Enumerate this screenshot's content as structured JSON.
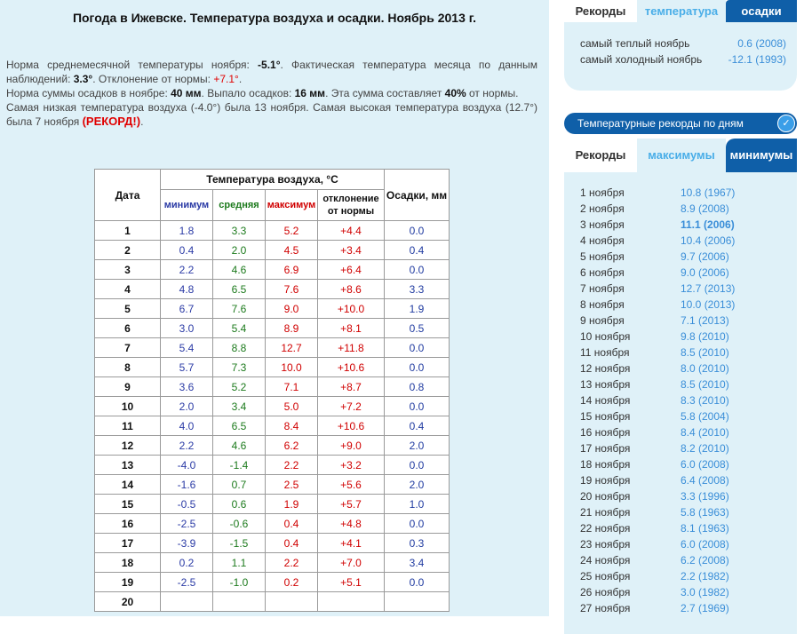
{
  "page": {
    "title": "Погода в Ижевске. Температура воздуха и осадки. Ноябрь 2013 г."
  },
  "summary": {
    "p1": {
      "t1": "Норма среднемесячной температуры ноября: ",
      "norm": "-5.1°",
      "t2": ". Фактическая температура месяца по данным наблюдений: ",
      "actual": "3.3°",
      "t3": ". Отклонение от нормы: ",
      "dev": "+7.1°",
      "t4": "."
    },
    "p2": {
      "t1": "Норма суммы осадков в ноябре: ",
      "norm": "40 мм",
      "t2": ". Выпало осадков: ",
      "fell": "16 мм",
      "t3": ". Эта сумма составляет ",
      "pct": "40%",
      "t4": " от нормы."
    },
    "p3": {
      "t1": "Самая низкая температура воздуха (-4.0°) была 13 ноября. Самая высокая температура воздуха (12.7°) была 7 ноября ",
      "record": "(РЕКОРД!)",
      "t2": "."
    }
  },
  "table": {
    "headers": {
      "date": "Дата",
      "temp": "Температура воздуха, °С",
      "min": "минимум",
      "avg": "средняя",
      "max": "максимум",
      "dev_line1": "отклонение",
      "dev_line2": "от нормы",
      "precip": "Осадки, мм"
    },
    "rows": [
      {
        "d": "1",
        "min": "1.8",
        "avg": "3.3",
        "max": "5.2",
        "dev": "+4.4",
        "p": "0.0"
      },
      {
        "d": "2",
        "min": "0.4",
        "avg": "2.0",
        "max": "4.5",
        "dev": "+3.4",
        "p": "0.4"
      },
      {
        "d": "3",
        "min": "2.2",
        "avg": "4.6",
        "max": "6.9",
        "dev": "+6.4",
        "p": "0.0"
      },
      {
        "d": "4",
        "min": "4.8",
        "avg": "6.5",
        "max": "7.6",
        "dev": "+8.6",
        "p": "3.3"
      },
      {
        "d": "5",
        "min": "6.7",
        "avg": "7.6",
        "max": "9.0",
        "dev": "+10.0",
        "p": "1.9"
      },
      {
        "d": "6",
        "min": "3.0",
        "avg": "5.4",
        "max": "8.9",
        "dev": "+8.1",
        "p": "0.5"
      },
      {
        "d": "7",
        "min": "5.4",
        "avg": "8.8",
        "max": "12.7",
        "dev": "+11.8",
        "p": "0.0"
      },
      {
        "d": "8",
        "min": "5.7",
        "avg": "7.3",
        "max": "10.0",
        "dev": "+10.6",
        "p": "0.0"
      },
      {
        "d": "9",
        "min": "3.6",
        "avg": "5.2",
        "max": "7.1",
        "dev": "+8.7",
        "p": "0.8"
      },
      {
        "d": "10",
        "min": "2.0",
        "avg": "3.4",
        "max": "5.0",
        "dev": "+7.2",
        "p": "0.0"
      },
      {
        "d": "11",
        "min": "4.0",
        "avg": "6.5",
        "max": "8.4",
        "dev": "+10.6",
        "p": "0.4"
      },
      {
        "d": "12",
        "min": "2.2",
        "avg": "4.6",
        "max": "6.2",
        "dev": "+9.0",
        "p": "2.0"
      },
      {
        "d": "13",
        "min": "-4.0",
        "avg": "-1.4",
        "max": "2.2",
        "dev": "+3.2",
        "p": "0.0"
      },
      {
        "d": "14",
        "min": "-1.6",
        "avg": "0.7",
        "max": "2.5",
        "dev": "+5.6",
        "p": "2.0"
      },
      {
        "d": "15",
        "min": "-0.5",
        "avg": "0.6",
        "max": "1.9",
        "dev": "+5.7",
        "p": "1.0"
      },
      {
        "d": "16",
        "min": "-2.5",
        "avg": "-0.6",
        "max": "0.4",
        "dev": "+4.8",
        "p": "0.0"
      },
      {
        "d": "17",
        "min": "-3.9",
        "avg": "-1.5",
        "max": "0.4",
        "dev": "+4.1",
        "p": "0.3"
      },
      {
        "d": "18",
        "min": "0.2",
        "avg": "1.1",
        "max": "2.2",
        "dev": "+7.0",
        "p": "3.4"
      },
      {
        "d": "19",
        "min": "-2.5",
        "avg": "-1.0",
        "max": "0.2",
        "dev": "+5.1",
        "p": "0.0"
      },
      {
        "d": "20",
        "min": "",
        "avg": "",
        "max": "",
        "dev": "",
        "p": ""
      }
    ]
  },
  "records": {
    "tabs": [
      "Рекорды",
      "температура",
      "осадки"
    ],
    "warmest_label": "самый теплый ноябрь",
    "warmest_value": "0.6 (2008)",
    "coldest_label": "самый холодный ноябрь",
    "coldest_value": "-12.1 (1993)"
  },
  "daily_records": {
    "header": "Температурные рекорды по дням",
    "tabs": [
      "Рекорды",
      "максимумы",
      "минимумы"
    ],
    "items": [
      {
        "day": "1 ноября",
        "value": "10.8 (1967)"
      },
      {
        "day": "2 ноября",
        "value": "8.9 (2008)"
      },
      {
        "day": "3 ноября",
        "value": "11.1 (2006)"
      },
      {
        "day": "4 ноября",
        "value": "10.4 (2006)"
      },
      {
        "day": "5 ноября",
        "value": "9.7 (2006)"
      },
      {
        "day": "6 ноября",
        "value": "9.0 (2006)"
      },
      {
        "day": "7 ноября",
        "value": "12.7 (2013)"
      },
      {
        "day": "8 ноября",
        "value": "10.0 (2013)"
      },
      {
        "day": "9 ноября",
        "value": "7.1 (2013)"
      },
      {
        "day": "10 ноября",
        "value": "9.8 (2010)"
      },
      {
        "day": "11 ноября",
        "value": "8.5 (2010)"
      },
      {
        "day": "12 ноября",
        "value": "8.0 (2010)"
      },
      {
        "day": "13 ноября",
        "value": "8.5 (2010)"
      },
      {
        "day": "14 ноября",
        "value": "8.3 (2010)"
      },
      {
        "day": "15 ноября",
        "value": "5.8 (2004)"
      },
      {
        "day": "16 ноября",
        "value": "8.4 (2010)"
      },
      {
        "day": "17 ноября",
        "value": "8.2 (2010)"
      },
      {
        "day": "18 ноября",
        "value": "6.0 (2008)"
      },
      {
        "day": "19 ноября",
        "value": "6.4 (2008)"
      },
      {
        "day": "20 ноября",
        "value": "3.3 (1996)"
      },
      {
        "day": "21 ноября",
        "value": "5.8 (1963)"
      },
      {
        "day": "22 ноября",
        "value": "8.1 (1963)"
      },
      {
        "day": "23 ноября",
        "value": "6.0 (2008)"
      },
      {
        "day": "24 ноября",
        "value": "6.2 (2008)"
      },
      {
        "day": "25 ноября",
        "value": "2.2 (1982)"
      },
      {
        "day": "26 ноября",
        "value": "3.0 (1982)"
      },
      {
        "day": "27 ноября",
        "value": "2.7 (1969)"
      }
    ]
  }
}
